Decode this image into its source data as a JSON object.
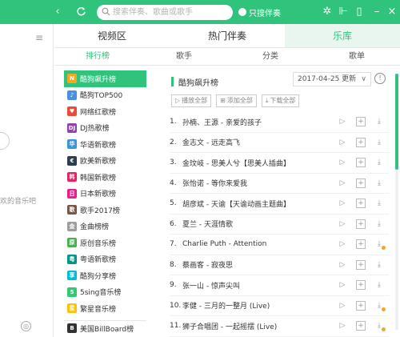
{
  "colors": {
    "accent": "#30c37c",
    "title_bar": "#30c37c",
    "badge": "#f5a623"
  },
  "search": {
    "placeholder": "搜索伴奏、歌曲或歌手"
  },
  "title_bar": {
    "only_companion": "只搜伴奏"
  },
  "left_strip": {
    "cutoff_text": "欢的音乐吧"
  },
  "main_tabs": [
    {
      "label": "视频区",
      "active": false
    },
    {
      "label": "热门伴奏",
      "active": false
    },
    {
      "label": "乐库",
      "active": true
    }
  ],
  "sub_tabs": [
    {
      "label": "排行榜",
      "active": true
    },
    {
      "label": "歌手",
      "active": false
    },
    {
      "label": "分类",
      "active": false
    },
    {
      "label": "歌单",
      "active": false
    }
  ],
  "charts": [
    {
      "label": "酷狗飙升榜",
      "icon": "N",
      "color": "#f5a623",
      "active": true
    },
    {
      "label": "酷狗TOP500",
      "icon": "♪",
      "color": "#4a90e2"
    },
    {
      "label": "网络红歌榜",
      "icon": "♥",
      "color": "#e74c3c"
    },
    {
      "label": "DJ热歌榜",
      "icon": "DJ",
      "color": "#8e44ad"
    },
    {
      "label": "华语新歌榜",
      "icon": "华",
      "color": "#3498db"
    },
    {
      "label": "欧美新歌榜",
      "icon": "€",
      "color": "#2c3e50"
    },
    {
      "label": "韩国新歌榜",
      "icon": "韩",
      "color": "#e91e63"
    },
    {
      "label": "日本新歌榜",
      "icon": "日",
      "color": "#e91e8c"
    },
    {
      "label": "歌手2017榜",
      "icon": "歌",
      "color": "#795548"
    },
    {
      "label": "金曲榜榜",
      "icon": "金",
      "color": "#9e9e9e"
    },
    {
      "label": "原创音乐榜",
      "icon": "原",
      "color": "#4caf50"
    },
    {
      "label": "粤语新歌榜",
      "icon": "粤",
      "color": "#009688"
    },
    {
      "label": "酷狗分享榜",
      "icon": "享",
      "color": "#00bcd4"
    },
    {
      "label": "5sing音乐榜",
      "icon": "5",
      "color": "#2ecc71"
    },
    {
      "label": "繁星音乐榜",
      "icon": "星",
      "color": "#ffc107"
    },
    {
      "label": "美国BillBoard榜",
      "icon": "B",
      "color": "#333333"
    }
  ],
  "content": {
    "title": "酷狗飙升榜",
    "date": "2017-04-25 更新",
    "actions": {
      "play_all": "播放全部",
      "add_all": "添加全部",
      "download_all": "下载全部"
    },
    "songs": [
      {
        "num": "1.",
        "title": "孙楠、王源 - 亲爱的孩子",
        "badge": false
      },
      {
        "num": "2.",
        "title": "金志文 - 远走高飞",
        "badge": false
      },
      {
        "num": "3.",
        "title": "金玟岐 - 思美人兮【思美人插曲】",
        "badge": false
      },
      {
        "num": "4.",
        "title": "张怡诺 - 等你来爱我",
        "badge": false
      },
      {
        "num": "5.",
        "title": "胡彦斌 - 天谕【天谕动画主题曲】",
        "badge": false
      },
      {
        "num": "6.",
        "title": "夏兰 - 天涯情歌",
        "badge": false
      },
      {
        "num": "7.",
        "title": "Charlie Puth - Attention",
        "badge": true
      },
      {
        "num": "8.",
        "title": "蔡画客 - 寂夜思",
        "badge": false
      },
      {
        "num": "9.",
        "title": "张一山 - 惊声尖叫",
        "badge": false
      },
      {
        "num": "10.",
        "title": "李健 - 三月的一整月 (Live)",
        "badge": true
      },
      {
        "num": "11.",
        "title": "狮子合唱团 - 一起摇摆 (Live)",
        "badge": true
      }
    ]
  }
}
